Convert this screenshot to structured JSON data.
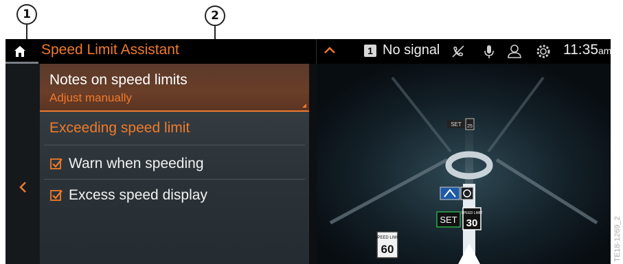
{
  "callouts": [
    "1",
    "2"
  ],
  "status_bar": {
    "title": "Speed Limit Assistant",
    "sim_badge": "1",
    "signal_text": "No signal",
    "clock_time": "11:35",
    "clock_ampm": "am",
    "icons": [
      "home-icon",
      "chevron-up-icon",
      "no-phone-icon",
      "microphone-icon",
      "profile-icon",
      "settings-gear-icon"
    ]
  },
  "menu": {
    "selected_title": "Notes on speed limits",
    "selected_subtitle": "Adjust manually",
    "section_header": "Exceeding speed limit",
    "options": [
      {
        "label": "Warn when speeding",
        "checked": true
      },
      {
        "label": "Excess speed display",
        "checked": true
      }
    ]
  },
  "map_signs": {
    "set_small": "SET",
    "limit_small": "25",
    "set_main": "SET",
    "limit_caption": "SPEED LIMIT",
    "limit_main": "30",
    "limit_bottom_caption": "SPEED LIMIT",
    "limit_bottom": "60"
  },
  "watermark": "TE18-1269_2",
  "colors": {
    "accent": "#f07a2a",
    "background": "#0d0f12"
  }
}
